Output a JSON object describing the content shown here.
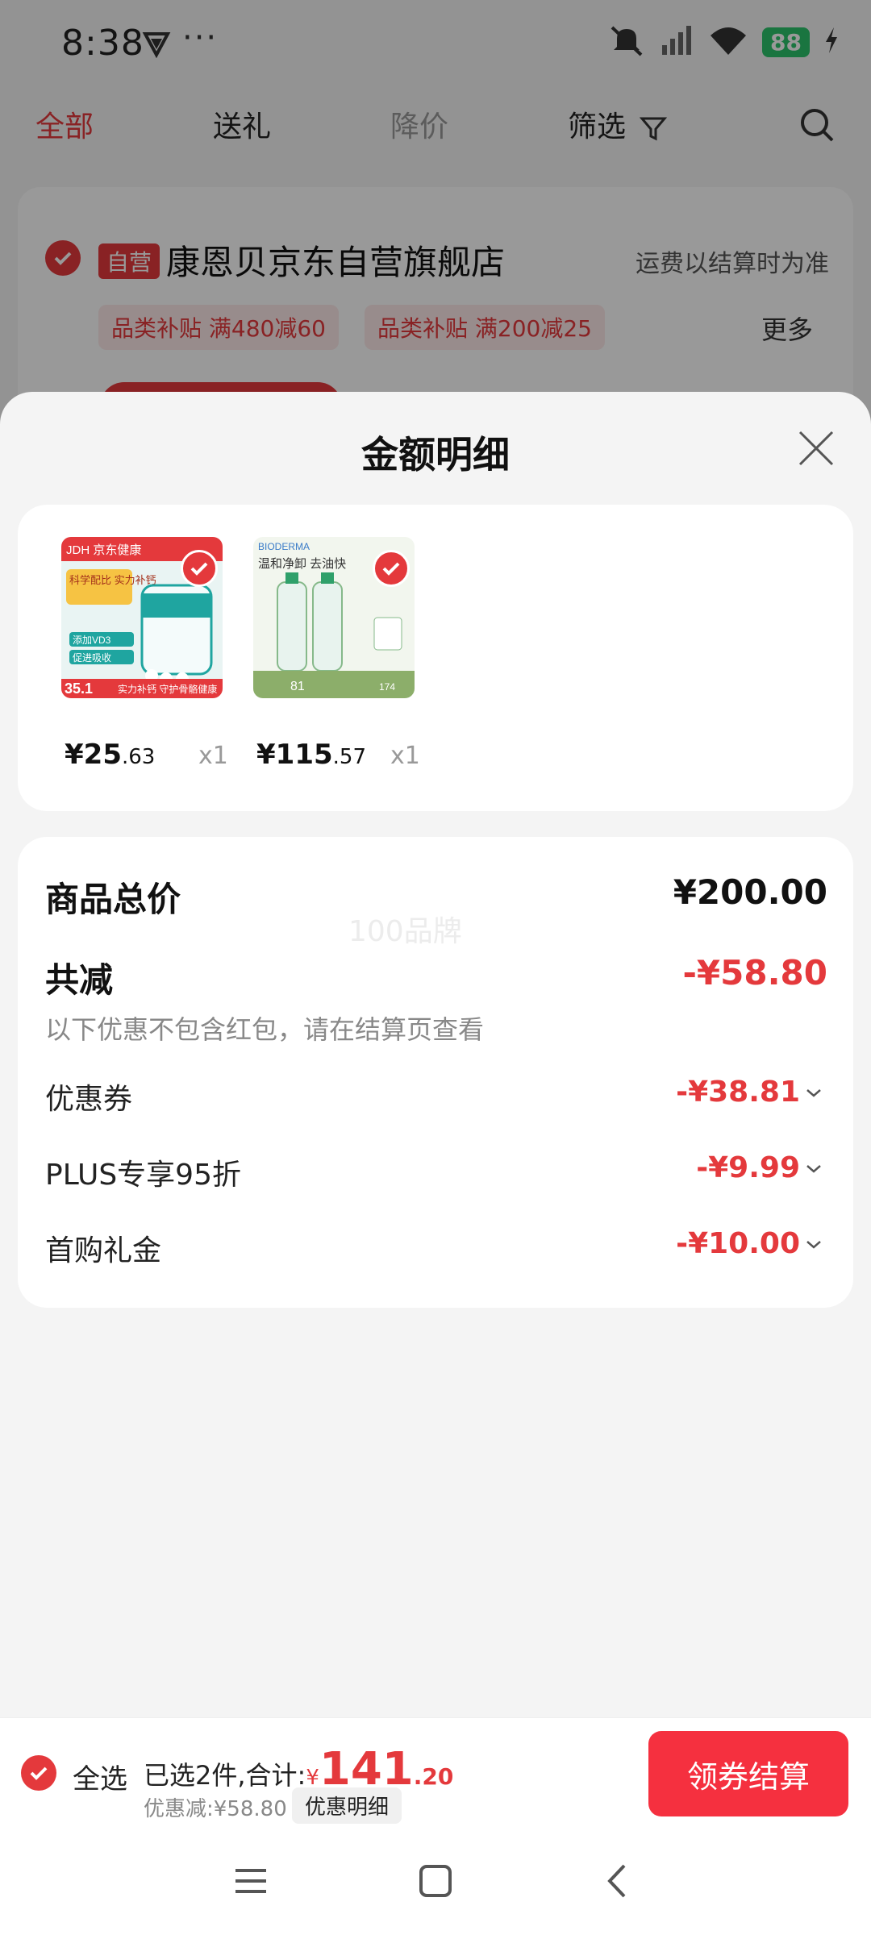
{
  "status_bar": {
    "time": "8:38",
    "more": "···",
    "battery": "88"
  },
  "tabs": [
    {
      "label": "全部"
    },
    {
      "label": "送礼"
    },
    {
      "label": "降价"
    },
    {
      "label": "筛选"
    }
  ],
  "store": {
    "badge": "自营",
    "name": "康恩贝京东自营旗舰店",
    "shipping_note": "运费以结算时为准",
    "promos": [
      "品类补贴 满480减60",
      "品类补贴 满200减25"
    ],
    "more": "更多"
  },
  "sheet": {
    "title": "金额明细",
    "products": [
      {
        "price_int": "¥25",
        "price_dec": ".63",
        "qty": "x1",
        "img_texts": [
          "JDH 京东健康",
          "科学配比 实力补钙",
          "添加VD3",
          "促进吸收",
          "35.1",
          "实力补钙 守护骨骼健康"
        ]
      },
      {
        "price_int": "¥115",
        "price_dec": ".57",
        "qty": "x1",
        "img_texts": [
          "BIODERMA",
          "温和净卸 去油快",
          "81",
          "174"
        ]
      }
    ],
    "summary": {
      "total_label": "商品总价",
      "total_value": "¥200.00",
      "watermark": "100品牌",
      "discount_label": "共减",
      "discount_value": "-¥58.80",
      "note": "以下优惠不包含红包，请在结算页查看",
      "rows": [
        {
          "label": "优惠券",
          "value": "-¥38.81"
        },
        {
          "label": "PLUS专享95折",
          "value": "-¥9.99"
        },
        {
          "label": "首购礼金",
          "value": "-¥10.00"
        }
      ]
    }
  },
  "bottom_bar": {
    "select_all": "全选",
    "selected_text": "已选2件,合计:",
    "currency": "¥",
    "total_int": "141",
    "total_dec": ".20",
    "discount_text": "优惠减:¥58.80",
    "detail_button": "优惠明细",
    "checkout": "领券结算"
  },
  "colors": {
    "accent": "#e4393c",
    "checkout": "#f5303f"
  }
}
